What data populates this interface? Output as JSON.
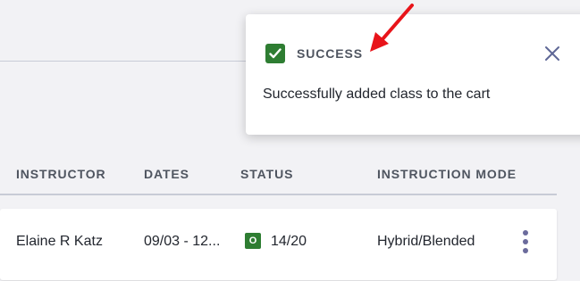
{
  "table": {
    "headers": [
      "INSTRUCTOR",
      "DATES",
      "STATUS",
      "INSTRUCTION MODE"
    ],
    "rows": [
      {
        "instructor": "Elaine R Katz",
        "dates": "09/03 - 12...",
        "status_badge": "O",
        "status": "14/20",
        "instruction_mode": "Hybrid/Blended"
      }
    ],
    "row_menu_icon": "kebab-menu-icon"
  },
  "toast": {
    "icon": "checkmark-icon",
    "title": "SUCCESS",
    "message": "Successfully added class to the cart",
    "close_icon": "close-icon"
  },
  "annotation": {
    "icon": "red-arrow-icon",
    "color": "#e8141a"
  },
  "colors": {
    "success_green": "#2e7d32",
    "accent_purple": "#6b6b9c"
  }
}
